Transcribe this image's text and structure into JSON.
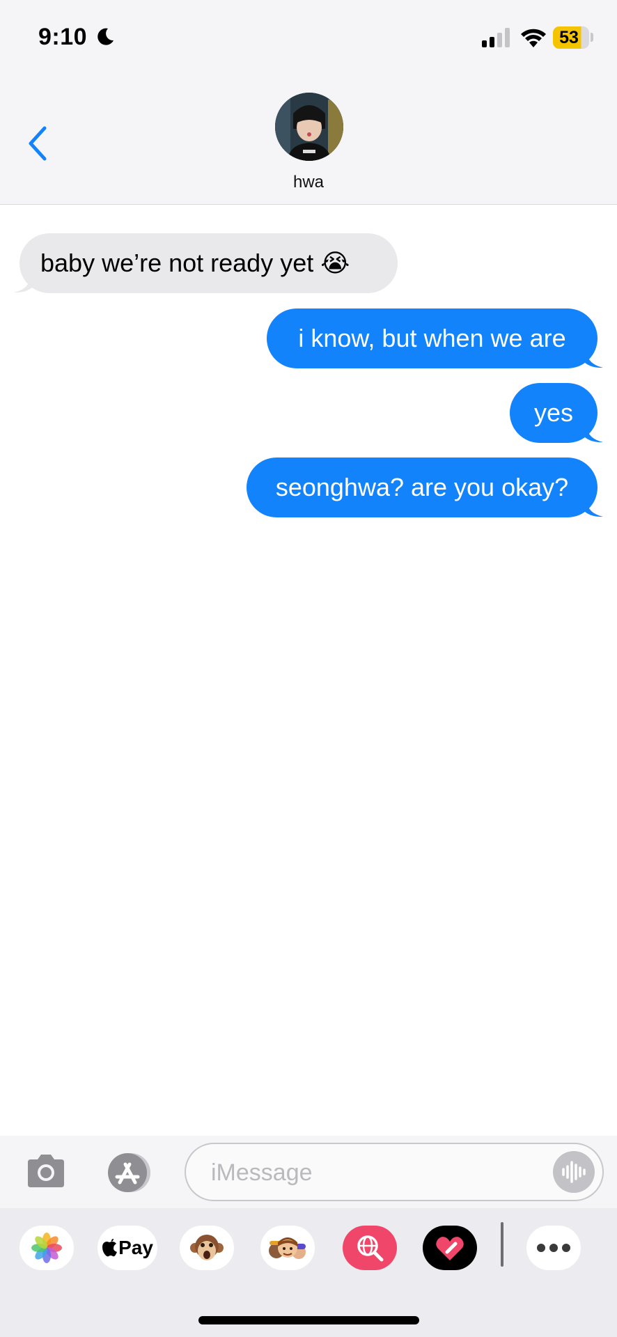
{
  "status_bar": {
    "time": "9:10",
    "battery_level": "53",
    "focus_icon": "moon-icon",
    "signal_icon": "cellular-signal-icon",
    "wifi_icon": "wifi-icon"
  },
  "header": {
    "contact_name": "hwa",
    "back_icon": "chevron-left-icon",
    "accent_color": "#1283fb"
  },
  "messages": [
    {
      "direction": "incoming",
      "text": "baby we’re not ready yet 😭"
    },
    {
      "direction": "outgoing",
      "text": "i know, but when we are"
    },
    {
      "direction": "outgoing",
      "text": "yes"
    },
    {
      "direction": "outgoing",
      "text": "seonghwa? are you okay?"
    }
  ],
  "composer": {
    "placeholder": "iMessage",
    "camera_icon": "camera-icon",
    "apps_icon": "app-store-icon",
    "audio_icon": "audio-waveform-icon"
  },
  "app_drawer": {
    "apps": [
      {
        "name": "photos",
        "icon": "photos-icon"
      },
      {
        "name": "apple-pay",
        "label": "Pay",
        "icon": "apple-logo-icon"
      },
      {
        "name": "memoji",
        "icon": "monkey-animoji-icon"
      },
      {
        "name": "memoji-stickers",
        "icon": "memoji-stickers-icon"
      },
      {
        "name": "search-images",
        "icon": "globe-search-icon"
      },
      {
        "name": "digital-touch",
        "icon": "heart-touch-icon"
      },
      {
        "name": "more",
        "icon": "more-icon"
      }
    ]
  }
}
